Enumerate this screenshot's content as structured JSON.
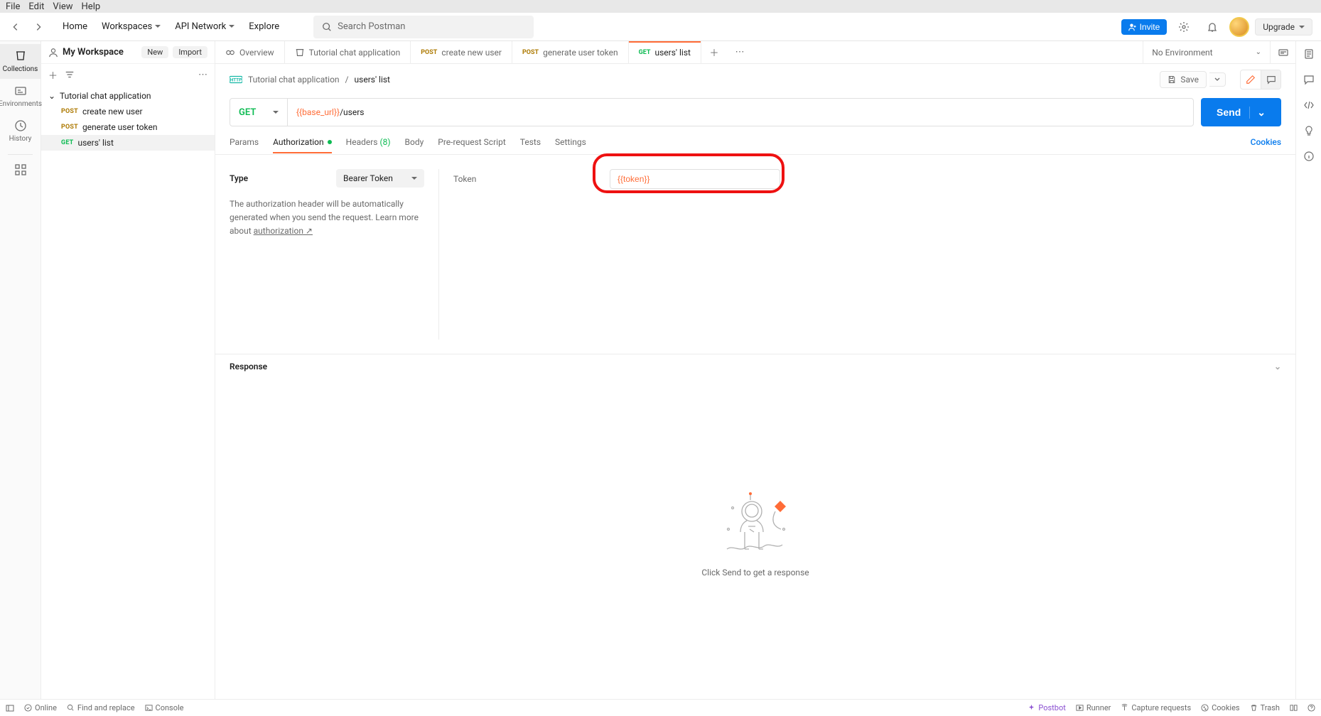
{
  "menubar": [
    "File",
    "Edit",
    "View",
    "Help"
  ],
  "header": {
    "home": "Home",
    "workspaces": "Workspaces",
    "api_network": "API Network",
    "explore": "Explore",
    "search_placeholder": "Search Postman",
    "invite": "Invite",
    "upgrade": "Upgrade"
  },
  "far_left": {
    "collections": "Collections",
    "environments": "Environments",
    "history": "History"
  },
  "workspace": {
    "title": "My Workspace",
    "new": "New",
    "import": "Import",
    "collection_name": "Tutorial chat application",
    "requests": [
      {
        "method": "POST",
        "name": "create new user"
      },
      {
        "method": "POST",
        "name": "generate user token"
      },
      {
        "method": "GET",
        "name": "users' list"
      }
    ]
  },
  "tabs": {
    "overview": "Overview",
    "t1_name": "Tutorial chat application",
    "t2_method": "POST",
    "t2_name": "create new user",
    "t3_method": "POST",
    "t3_name": "generate user token",
    "t4_method": "GET",
    "t4_name": "users' list",
    "env": "No Environment"
  },
  "breadcrumb": {
    "parent": "Tutorial chat application",
    "sep": "/",
    "current": "users' list",
    "save": "Save"
  },
  "request": {
    "method": "GET",
    "url_var": "{{base_url}}",
    "url_path": "/users",
    "send": "Send"
  },
  "req_tabs": {
    "params": "Params",
    "auth": "Authorization",
    "headers": "Headers",
    "headers_count": "(8)",
    "body": "Body",
    "prereq": "Pre-request Script",
    "tests": "Tests",
    "settings": "Settings",
    "cookies": "Cookies"
  },
  "auth": {
    "type_label": "Type",
    "type_value": "Bearer Token",
    "note_pre": "The authorization header will be automatically generated when you send the request. Learn more about ",
    "note_link": "authorization",
    "token_label": "Token",
    "token_value": "{{token}}"
  },
  "response": {
    "title": "Response",
    "empty": "Click Send to get a response"
  },
  "statusbar": {
    "online": "Online",
    "find": "Find and replace",
    "console": "Console",
    "postbot": "Postbot",
    "runner": "Runner",
    "capture": "Capture requests",
    "cookies": "Cookies",
    "trash": "Trash"
  }
}
